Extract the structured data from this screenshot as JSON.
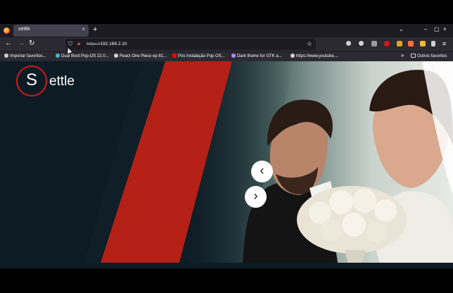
{
  "browser": {
    "tab_title": "settle",
    "tab_close": "×",
    "new_tab": "+",
    "tab_list": "⌄",
    "window_controls": [
      "–",
      "▢",
      "×"
    ],
    "url_scheme": "https://",
    "url_host": "192.168.2.10",
    "bookmarks": [
      {
        "label": "Importar favoritos...",
        "icon": "bookmark-import-icon",
        "color": "#cfcfd8"
      },
      {
        "label": "Dual Boot Pop-OS 22.0...",
        "icon": "pop-os-icon",
        "color": "#48b9c7"
      },
      {
        "label": "React One Piece ep 81...",
        "icon": "globe-icon",
        "color": "#cfcfd8"
      },
      {
        "label": "Pós instalação Pop OS...",
        "icon": "youtube-icon",
        "color": "#ff0000"
      },
      {
        "label": "Dark theme for GTK a...",
        "icon": "github-icon",
        "color": "#b388ff"
      },
      {
        "label": "https://www.youtube....",
        "icon": "globe-icon",
        "color": "#cfcfd8"
      }
    ],
    "bookmarks_overflow": "»",
    "other_bookmarks": "Outros favoritos"
  },
  "site": {
    "logo_initial": "S",
    "logo_rest": "ettle",
    "slider_prev": "‹",
    "slider_next": "›"
  },
  "colors": {
    "brand_red": "#d11a1a",
    "page_bg": "#0d1b24"
  }
}
